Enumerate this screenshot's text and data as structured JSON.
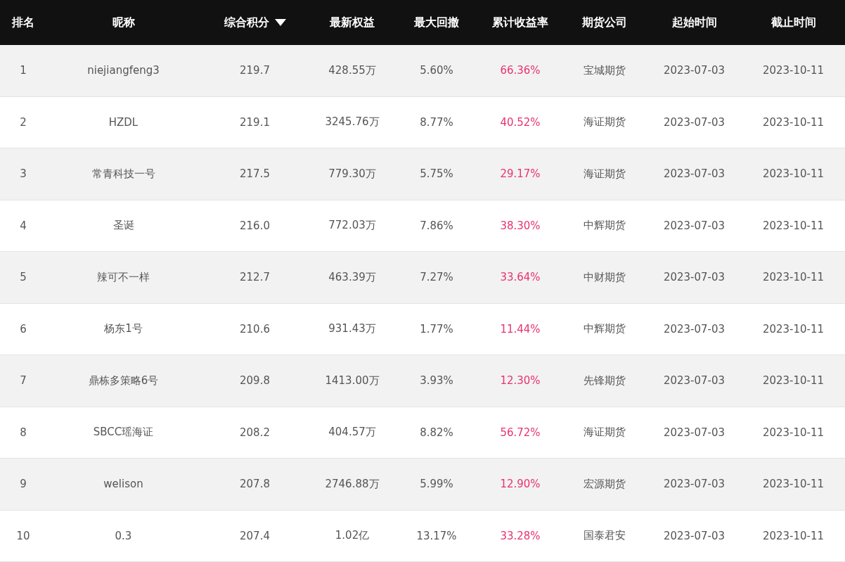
{
  "table": {
    "columns": [
      {
        "label": "排名",
        "sorted": false
      },
      {
        "label": "昵称",
        "sorted": false
      },
      {
        "label": "综合积分",
        "sorted": true
      },
      {
        "label": "最新权益",
        "sorted": false
      },
      {
        "label": "最大回撤",
        "sorted": false
      },
      {
        "label": "累计收益率",
        "sorted": false
      },
      {
        "label": "期货公司",
        "sorted": false
      },
      {
        "label": "起始时间",
        "sorted": false
      },
      {
        "label": "截止时间",
        "sorted": false
      }
    ],
    "rows": [
      {
        "rank": "1",
        "nickname": "niejiangfeng3",
        "score": "219.7",
        "equity": "428.55万",
        "drawdown": "5.60%",
        "return": "66.36%",
        "company": "宝城期货",
        "start": "2023-07-03",
        "end": "2023-10-11"
      },
      {
        "rank": "2",
        "nickname": "HZDL",
        "score": "219.1",
        "equity": "3245.76万",
        "drawdown": "8.77%",
        "return": "40.52%",
        "company": "海证期货",
        "start": "2023-07-03",
        "end": "2023-10-11"
      },
      {
        "rank": "3",
        "nickname": "常青科技一号",
        "score": "217.5",
        "equity": "779.30万",
        "drawdown": "5.75%",
        "return": "29.17%",
        "company": "海证期货",
        "start": "2023-07-03",
        "end": "2023-10-11"
      },
      {
        "rank": "4",
        "nickname": "圣诞",
        "score": "216.0",
        "equity": "772.03万",
        "drawdown": "7.86%",
        "return": "38.30%",
        "company": "中辉期货",
        "start": "2023-07-03",
        "end": "2023-10-11"
      },
      {
        "rank": "5",
        "nickname": "辣可不一样",
        "score": "212.7",
        "equity": "463.39万",
        "drawdown": "7.27%",
        "return": "33.64%",
        "company": "中财期货",
        "start": "2023-07-03",
        "end": "2023-10-11"
      },
      {
        "rank": "6",
        "nickname": "杨东1号",
        "score": "210.6",
        "equity": "931.43万",
        "drawdown": "1.77%",
        "return": "11.44%",
        "company": "中辉期货",
        "start": "2023-07-03",
        "end": "2023-10-11"
      },
      {
        "rank": "7",
        "nickname": "鼎栋多策略6号",
        "score": "209.8",
        "equity": "1413.00万",
        "drawdown": "3.93%",
        "return": "12.30%",
        "company": "先锋期货",
        "start": "2023-07-03",
        "end": "2023-10-11"
      },
      {
        "rank": "8",
        "nickname": "SBCC瑶海证",
        "score": "208.2",
        "equity": "404.57万",
        "drawdown": "8.82%",
        "return": "56.72%",
        "company": "海证期货",
        "start": "2023-07-03",
        "end": "2023-10-11"
      },
      {
        "rank": "9",
        "nickname": "welison",
        "score": "207.8",
        "equity": "2746.88万",
        "drawdown": "5.99%",
        "return": "12.90%",
        "company": "宏源期货",
        "start": "2023-07-03",
        "end": "2023-10-11"
      },
      {
        "rank": "10",
        "nickname": "0.3",
        "score": "207.4",
        "equity": "1.02亿",
        "drawdown": "13.17%",
        "return": "33.28%",
        "company": "国泰君安",
        "start": "2023-07-03",
        "end": "2023-10-11"
      }
    ]
  }
}
